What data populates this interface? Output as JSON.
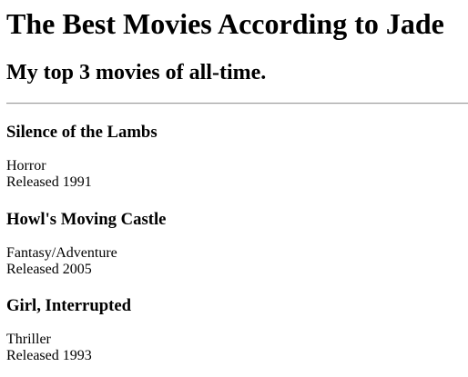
{
  "page": {
    "title": "The Best Movies According to Jade",
    "subtitle": "My top 3 movies of all-time."
  },
  "movies": [
    {
      "title": "Silence of the Lambs",
      "genre": "Horror",
      "released": "Released 1991"
    },
    {
      "title": "Howl's Moving Castle",
      "genre": "Fantasy/Adventure",
      "released": "Released 2005"
    },
    {
      "title": "Girl, Interrupted",
      "genre": "Thriller",
      "released": "Released 1993"
    }
  ],
  "colors": {
    "text": "#000000",
    "background": "#ffffff",
    "rule": "#9a9a9a"
  }
}
